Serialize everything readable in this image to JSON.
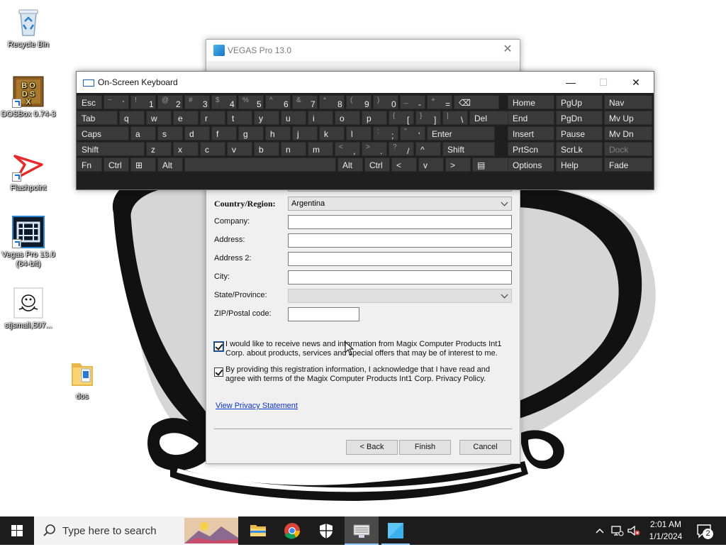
{
  "desktop": {
    "icons": [
      {
        "label": "Recycle Bin"
      },
      {
        "label": "DOSBox 0.74-3"
      },
      {
        "label": "Flashpoint"
      },
      {
        "label": "Vegas Pro 13.0 (64-bit)"
      },
      {
        "label": "stjsmall,507..."
      },
      {
        "label": "dos"
      }
    ]
  },
  "vegas_dialog": {
    "title": "VEGAS Pro 13.0",
    "fields": {
      "country_label": "Country/Region:",
      "country_value": "Argentina",
      "company_label": "Company:",
      "address_label": "Address:",
      "address2_label": "Address 2:",
      "city_label": "City:",
      "state_label": "State/Province:",
      "state_value": "",
      "zip_label": "ZIP/Postal code:"
    },
    "checkboxes": [
      {
        "checked": true,
        "text": "I would like to receive news and information from Magix Computer Products Int1 Corp. about products, services and special offers that may be of interest to me."
      },
      {
        "checked": true,
        "text": "By providing this registration information, I acknowledge that I have read and agree with terms of the Magix Computer Products Int1 Corp. Privacy Policy."
      }
    ],
    "privacy_link": "View Privacy Statement",
    "buttons": {
      "back": "< Back",
      "finish": "Finish",
      "cancel": "Cancel"
    }
  },
  "osk": {
    "title": "On-Screen Keyboard",
    "window_buttons": {
      "minimize": "—",
      "maximize": "☐",
      "close": "✕"
    },
    "rows": [
      [
        {
          "p": "Esc"
        },
        {
          "s": "~",
          "m": "`"
        },
        {
          "s": "!",
          "m": "1"
        },
        {
          "s": "@",
          "m": "2"
        },
        {
          "s": "#",
          "m": "3"
        },
        {
          "s": "$",
          "m": "4"
        },
        {
          "s": "%",
          "m": "5"
        },
        {
          "s": "^",
          "m": "6"
        },
        {
          "s": "&",
          "m": "7"
        },
        {
          "s": "*",
          "m": "8"
        },
        {
          "s": "(",
          "m": "9"
        },
        {
          "s": ")",
          "m": "0"
        },
        {
          "s": "_",
          "m": "-"
        },
        {
          "s": "+",
          "m": "="
        },
        {
          "p": "⌫"
        }
      ],
      [
        {
          "p": "Tab"
        },
        {
          "p": "q"
        },
        {
          "p": "w"
        },
        {
          "p": "e"
        },
        {
          "p": "r"
        },
        {
          "p": "t"
        },
        {
          "p": "y"
        },
        {
          "p": "u"
        },
        {
          "p": "i"
        },
        {
          "p": "o"
        },
        {
          "p": "p"
        },
        {
          "s": "{",
          "m": "["
        },
        {
          "s": "}",
          "m": "]"
        },
        {
          "s": "|",
          "m": "\\"
        },
        {
          "p": "Del"
        }
      ],
      [
        {
          "p": "Caps"
        },
        {
          "p": "a"
        },
        {
          "p": "s"
        },
        {
          "p": "d"
        },
        {
          "p": "f"
        },
        {
          "p": "g"
        },
        {
          "p": "h"
        },
        {
          "p": "j"
        },
        {
          "p": "k"
        },
        {
          "p": "l"
        },
        {
          "s": ":",
          "m": ";"
        },
        {
          "s": "\"",
          "m": "'"
        },
        {
          "p": "Enter"
        }
      ],
      [
        {
          "p": "Shift"
        },
        {
          "p": "z"
        },
        {
          "p": "x"
        },
        {
          "p": "c"
        },
        {
          "p": "v"
        },
        {
          "p": "b"
        },
        {
          "p": "n"
        },
        {
          "p": "m"
        },
        {
          "s": "<",
          "m": ","
        },
        {
          "s": ">",
          "m": "."
        },
        {
          "s": "?",
          "m": "/"
        },
        {
          "p": "^"
        },
        {
          "p": "Shift"
        }
      ],
      [
        {
          "p": "Fn"
        },
        {
          "p": "Ctrl"
        },
        {
          "p": "⊞"
        },
        {
          "p": "Alt"
        },
        {
          "p": ""
        },
        {
          "p": "Alt"
        },
        {
          "p": "Ctrl"
        },
        {
          "p": "<"
        },
        {
          "p": "v"
        },
        {
          "p": ">"
        },
        {
          "p": "▤"
        }
      ]
    ],
    "nav_rows": [
      [
        "Home",
        "PgUp",
        "Nav"
      ],
      [
        "End",
        "PgDn",
        "Mv Up"
      ],
      [
        "Insert",
        "Pause",
        "Mv Dn"
      ],
      [
        "PrtScn",
        "ScrLk",
        "Dock"
      ],
      [
        "Options",
        "Help",
        "Fade"
      ]
    ]
  },
  "taskbar": {
    "search_placeholder": "Type here to search",
    "time": "2:01 AM",
    "date": "1/1/2024",
    "notification_count": "2"
  },
  "colors": {
    "osk_bg": "#1f1f1f",
    "osk_key": "#3a3a3a",
    "taskbar": "#1c1c1c",
    "link": "#0b33c8"
  }
}
